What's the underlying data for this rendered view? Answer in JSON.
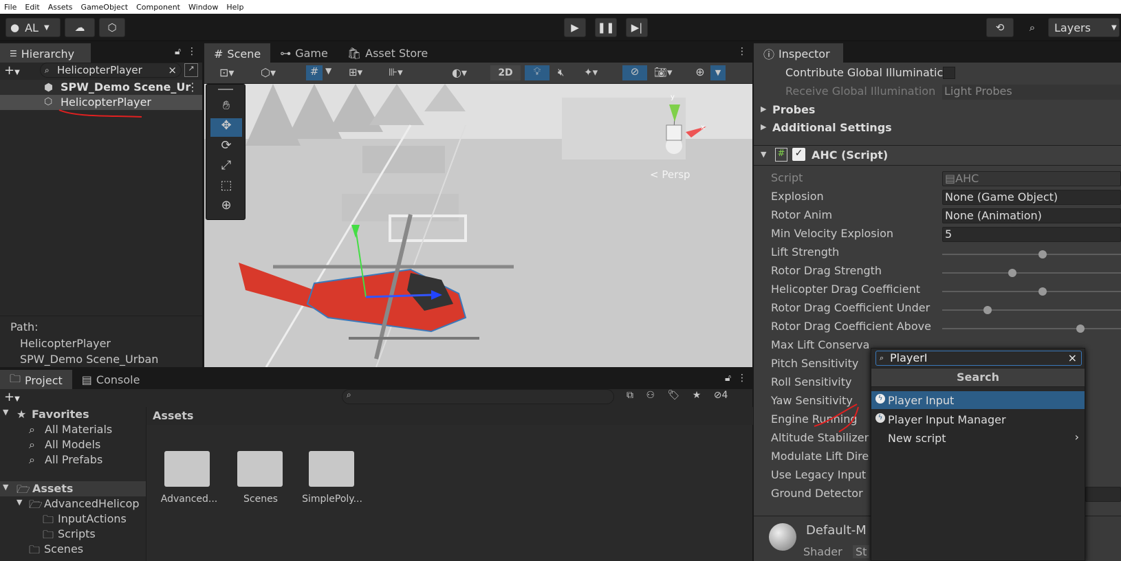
{
  "menu": [
    "File",
    "Edit",
    "Assets",
    "GameObject",
    "Component",
    "Window",
    "Help"
  ],
  "toolbar": {
    "account": "AL",
    "layers": "Layers"
  },
  "hierarchy": {
    "tab": "Hierarchy",
    "search": "HelicopterPlayer",
    "scene": "SPW_Demo Scene_Ur",
    "item": "HelicopterPlayer",
    "path_label": "Path:",
    "path_1": "HelicopterPlayer",
    "path_2": "SPW_Demo Scene_Urban"
  },
  "scene_tabs": {
    "scene": "Scene",
    "game": "Game",
    "asset_store": "Asset Store"
  },
  "scene_toolbar": {
    "mode2d": "2D"
  },
  "scene_view": {
    "persp": "< Persp",
    "axis_x": "x",
    "axis_y": "y"
  },
  "project": {
    "tab_project": "Project",
    "tab_console": "Console",
    "hidden_count": "4",
    "favorites": "Favorites",
    "fav_items": [
      "All Materials",
      "All Models",
      "All Prefabs"
    ],
    "assets_root": "Assets",
    "tree": [
      "AdvancedHelicop",
      "InputActions",
      "Scripts",
      "Scenes"
    ],
    "breadcrumb": "Assets",
    "folders": [
      "Advanced...",
      "Scenes",
      "SimplePoly..."
    ]
  },
  "inspector": {
    "tab": "Inspector",
    "contribute_gi": "Contribute Global Illuminatic",
    "receive_gi": "Receive Global Illumination",
    "receive_gi_value": "Light Probes",
    "probes": "Probes",
    "additional": "Additional Settings",
    "component": "AHC (Script)",
    "fields": [
      {
        "label": "Script",
        "value": "AHC"
      },
      {
        "label": "Explosion",
        "value": "None (Game Object)"
      },
      {
        "label": "Rotor Anim",
        "value": "None (Animation)"
      },
      {
        "label": "Min Velocity Explosion",
        "value": "5"
      },
      {
        "label": "Lift Strength",
        "slider": 0.54
      },
      {
        "label": "Rotor Drag Strength",
        "slider": 0.37
      },
      {
        "label": "Helicopter Drag Coefficient",
        "slider": 0.54
      },
      {
        "label": "Rotor Drag Coefficient Under",
        "slider": 0.23
      },
      {
        "label": "Rotor Drag Coefficient Above",
        "slider": 0.75
      },
      {
        "label": "Max Lift Conserva"
      },
      {
        "label": "Pitch Sensitivity"
      },
      {
        "label": "Roll Sensitivity"
      },
      {
        "label": "Yaw Sensitivity"
      },
      {
        "label": "Engine Running"
      },
      {
        "label": "Altitude Stabilizer"
      },
      {
        "label": "Modulate Lift Dire"
      },
      {
        "label": "Use Legacy Input"
      },
      {
        "label": "Ground Detector"
      }
    ],
    "material": "Default-M",
    "shader_label": "Shader",
    "shader_value": "St"
  },
  "popup": {
    "query": "PlayerI",
    "title": "Search",
    "items": [
      "Player Input",
      "Player Input Manager",
      "New script"
    ]
  },
  "colors": {
    "selection": "#2c5d87",
    "accent": "#3a79bb",
    "heli_red": "#d8392b"
  }
}
